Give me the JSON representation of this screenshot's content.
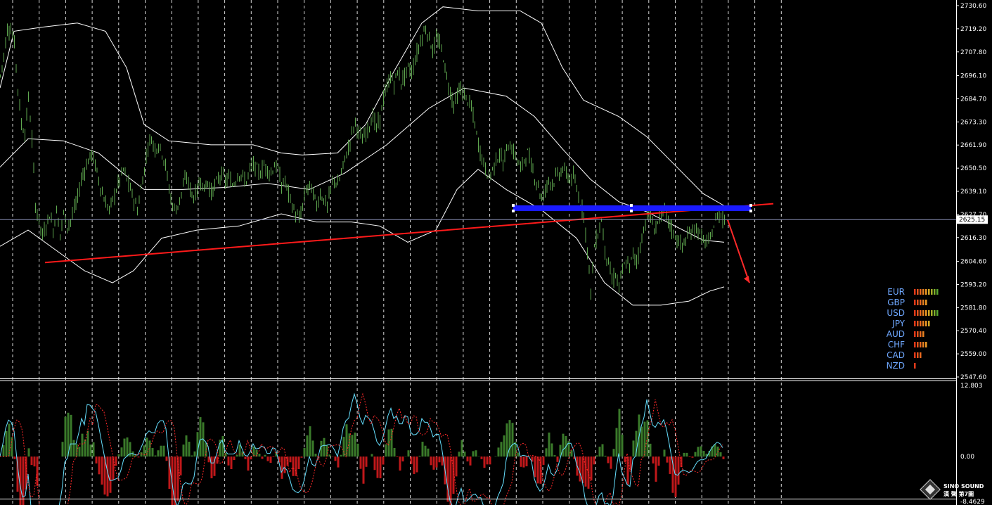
{
  "chart_data": [
    {
      "type": "candlestick",
      "panel": "main",
      "y_ticks": [
        "2730.60",
        "2719.20",
        "2707.80",
        "2696.10",
        "2684.70",
        "2673.30",
        "2661.90",
        "2650.50",
        "2639.10",
        "2627.70",
        "2616.30",
        "2604.60",
        "2593.20",
        "2581.80",
        "2570.40",
        "2559.00",
        "2547.60"
      ],
      "ylim": [
        2547.6,
        2730.6
      ],
      "current_price": "2625.15",
      "price_series": [
        {
          "x": 0,
          "y": 2696
        },
        {
          "x": 5,
          "y": 2706
        },
        {
          "x": 10,
          "y": 2719
        },
        {
          "x": 15,
          "y": 2719
        },
        {
          "x": 20,
          "y": 2712
        },
        {
          "x": 25,
          "y": 2690
        },
        {
          "x": 30,
          "y": 2672
        },
        {
          "x": 35,
          "y": 2668
        },
        {
          "x": 40,
          "y": 2685
        },
        {
          "x": 45,
          "y": 2665
        },
        {
          "x": 50,
          "y": 2632
        },
        {
          "x": 55,
          "y": 2625
        },
        {
          "x": 60,
          "y": 2617
        },
        {
          "x": 65,
          "y": 2622
        },
        {
          "x": 70,
          "y": 2628
        },
        {
          "x": 75,
          "y": 2620
        },
        {
          "x": 80,
          "y": 2630
        },
        {
          "x": 85,
          "y": 2618
        },
        {
          "x": 90,
          "y": 2628
        },
        {
          "x": 95,
          "y": 2622
        },
        {
          "x": 100,
          "y": 2625
        },
        {
          "x": 105,
          "y": 2630
        },
        {
          "x": 110,
          "y": 2636
        },
        {
          "x": 115,
          "y": 2645
        },
        {
          "x": 120,
          "y": 2650
        },
        {
          "x": 125,
          "y": 2654
        },
        {
          "x": 130,
          "y": 2658
        },
        {
          "x": 135,
          "y": 2652
        },
        {
          "x": 140,
          "y": 2645
        },
        {
          "x": 145,
          "y": 2638
        },
        {
          "x": 150,
          "y": 2633
        },
        {
          "x": 155,
          "y": 2630
        },
        {
          "x": 160,
          "y": 2635
        },
        {
          "x": 165,
          "y": 2640
        },
        {
          "x": 170,
          "y": 2645
        },
        {
          "x": 175,
          "y": 2650
        },
        {
          "x": 180,
          "y": 2645
        },
        {
          "x": 185,
          "y": 2640
        },
        {
          "x": 190,
          "y": 2635
        },
        {
          "x": 195,
          "y": 2630
        },
        {
          "x": 200,
          "y": 2640
        },
        {
          "x": 205,
          "y": 2650
        },
        {
          "x": 210,
          "y": 2662
        },
        {
          "x": 215,
          "y": 2665
        },
        {
          "x": 220,
          "y": 2660
        },
        {
          "x": 225,
          "y": 2662
        },
        {
          "x": 230,
          "y": 2658
        },
        {
          "x": 235,
          "y": 2652
        },
        {
          "x": 240,
          "y": 2640
        },
        {
          "x": 245,
          "y": 2632
        },
        {
          "x": 250,
          "y": 2630
        },
        {
          "x": 255,
          "y": 2635
        },
        {
          "x": 260,
          "y": 2642
        },
        {
          "x": 265,
          "y": 2646
        },
        {
          "x": 270,
          "y": 2640
        },
        {
          "x": 275,
          "y": 2636
        },
        {
          "x": 280,
          "y": 2640
        },
        {
          "x": 285,
          "y": 2645
        },
        {
          "x": 290,
          "y": 2640
        },
        {
          "x": 295,
          "y": 2644
        },
        {
          "x": 300,
          "y": 2638
        },
        {
          "x": 305,
          "y": 2642
        },
        {
          "x": 310,
          "y": 2645
        },
        {
          "x": 315,
          "y": 2648
        },
        {
          "x": 320,
          "y": 2644
        },
        {
          "x": 325,
          "y": 2646
        },
        {
          "x": 330,
          "y": 2642
        },
        {
          "x": 335,
          "y": 2645
        },
        {
          "x": 340,
          "y": 2648
        },
        {
          "x": 345,
          "y": 2646
        },
        {
          "x": 350,
          "y": 2644
        },
        {
          "x": 355,
          "y": 2650
        },
        {
          "x": 360,
          "y": 2652
        },
        {
          "x": 365,
          "y": 2650
        },
        {
          "x": 370,
          "y": 2648
        },
        {
          "x": 375,
          "y": 2652
        },
        {
          "x": 380,
          "y": 2650
        },
        {
          "x": 385,
          "y": 2648
        },
        {
          "x": 390,
          "y": 2652
        },
        {
          "x": 395,
          "y": 2650
        },
        {
          "x": 400,
          "y": 2642
        },
        {
          "x": 405,
          "y": 2644
        },
        {
          "x": 410,
          "y": 2638
        },
        {
          "x": 415,
          "y": 2632
        },
        {
          "x": 420,
          "y": 2628
        },
        {
          "x": 425,
          "y": 2625
        },
        {
          "x": 430,
          "y": 2632
        },
        {
          "x": 435,
          "y": 2640
        },
        {
          "x": 440,
          "y": 2642
        },
        {
          "x": 445,
          "y": 2638
        },
        {
          "x": 450,
          "y": 2632
        },
        {
          "x": 455,
          "y": 2638
        },
        {
          "x": 460,
          "y": 2635
        },
        {
          "x": 465,
          "y": 2632
        },
        {
          "x": 470,
          "y": 2640
        },
        {
          "x": 475,
          "y": 2645
        },
        {
          "x": 480,
          "y": 2642
        },
        {
          "x": 485,
          "y": 2648
        },
        {
          "x": 490,
          "y": 2655
        },
        {
          "x": 495,
          "y": 2660
        },
        {
          "x": 500,
          "y": 2668
        },
        {
          "x": 505,
          "y": 2673
        },
        {
          "x": 510,
          "y": 2668
        },
        {
          "x": 515,
          "y": 2664
        },
        {
          "x": 520,
          "y": 2668
        },
        {
          "x": 525,
          "y": 2672
        },
        {
          "x": 530,
          "y": 2676
        },
        {
          "x": 535,
          "y": 2670
        },
        {
          "x": 540,
          "y": 2675
        },
        {
          "x": 545,
          "y": 2685
        },
        {
          "x": 550,
          "y": 2690
        },
        {
          "x": 555,
          "y": 2696
        },
        {
          "x": 560,
          "y": 2692
        },
        {
          "x": 565,
          "y": 2698
        },
        {
          "x": 570,
          "y": 2693
        },
        {
          "x": 575,
          "y": 2696
        },
        {
          "x": 580,
          "y": 2700
        },
        {
          "x": 585,
          "y": 2698
        },
        {
          "x": 590,
          "y": 2704
        },
        {
          "x": 595,
          "y": 2710
        },
        {
          "x": 600,
          "y": 2716
        },
        {
          "x": 605,
          "y": 2719
        },
        {
          "x": 610,
          "y": 2715
        },
        {
          "x": 615,
          "y": 2708
        },
        {
          "x": 620,
          "y": 2714
        },
        {
          "x": 625,
          "y": 2712
        },
        {
          "x": 630,
          "y": 2705
        },
        {
          "x": 635,
          "y": 2695
        },
        {
          "x": 640,
          "y": 2688
        },
        {
          "x": 645,
          "y": 2682
        },
        {
          "x": 650,
          "y": 2686
        },
        {
          "x": 655,
          "y": 2690
        },
        {
          "x": 660,
          "y": 2686
        },
        {
          "x": 665,
          "y": 2684
        },
        {
          "x": 670,
          "y": 2680
        },
        {
          "x": 675,
          "y": 2672
        },
        {
          "x": 680,
          "y": 2662
        },
        {
          "x": 685,
          "y": 2656
        },
        {
          "x": 690,
          "y": 2650
        },
        {
          "x": 695,
          "y": 2646
        },
        {
          "x": 700,
          "y": 2650
        },
        {
          "x": 705,
          "y": 2654
        },
        {
          "x": 710,
          "y": 2658
        },
        {
          "x": 715,
          "y": 2652
        },
        {
          "x": 720,
          "y": 2660
        },
        {
          "x": 725,
          "y": 2662
        },
        {
          "x": 730,
          "y": 2658
        },
        {
          "x": 735,
          "y": 2655
        },
        {
          "x": 740,
          "y": 2650
        },
        {
          "x": 745,
          "y": 2655
        },
        {
          "x": 750,
          "y": 2658
        },
        {
          "x": 755,
          "y": 2652
        },
        {
          "x": 760,
          "y": 2646
        },
        {
          "x": 765,
          "y": 2642
        },
        {
          "x": 770,
          "y": 2635
        },
        {
          "x": 775,
          "y": 2640
        },
        {
          "x": 780,
          "y": 2645
        },
        {
          "x": 785,
          "y": 2643
        },
        {
          "x": 790,
          "y": 2646
        },
        {
          "x": 795,
          "y": 2648
        },
        {
          "x": 800,
          "y": 2650
        },
        {
          "x": 805,
          "y": 2648
        },
        {
          "x": 810,
          "y": 2645
        },
        {
          "x": 815,
          "y": 2646
        },
        {
          "x": 820,
          "y": 2640
        },
        {
          "x": 825,
          "y": 2633
        },
        {
          "x": 830,
          "y": 2628
        },
        {
          "x": 835,
          "y": 2610
        },
        {
          "x": 840,
          "y": 2590
        },
        {
          "x": 845,
          "y": 2612
        },
        {
          "x": 850,
          "y": 2618
        },
        {
          "x": 855,
          "y": 2625
        },
        {
          "x": 860,
          "y": 2610
        },
        {
          "x": 865,
          "y": 2604
        },
        {
          "x": 870,
          "y": 2595
        },
        {
          "x": 875,
          "y": 2598
        },
        {
          "x": 880,
          "y": 2592
        },
        {
          "x": 885,
          "y": 2600
        },
        {
          "x": 890,
          "y": 2604
        },
        {
          "x": 895,
          "y": 2602
        },
        {
          "x": 900,
          "y": 2608
        },
        {
          "x": 905,
          "y": 2605
        },
        {
          "x": 910,
          "y": 2612
        },
        {
          "x": 915,
          "y": 2620
        },
        {
          "x": 920,
          "y": 2628
        },
        {
          "x": 925,
          "y": 2626
        },
        {
          "x": 930,
          "y": 2620
        },
        {
          "x": 935,
          "y": 2624
        },
        {
          "x": 940,
          "y": 2628
        },
        {
          "x": 945,
          "y": 2629
        },
        {
          "x": 950,
          "y": 2625
        },
        {
          "x": 955,
          "y": 2620
        },
        {
          "x": 960,
          "y": 2617
        },
        {
          "x": 965,
          "y": 2614
        },
        {
          "x": 970,
          "y": 2612
        },
        {
          "x": 975,
          "y": 2615
        },
        {
          "x": 980,
          "y": 2618
        },
        {
          "x": 985,
          "y": 2620
        },
        {
          "x": 990,
          "y": 2621
        },
        {
          "x": 995,
          "y": 2618
        },
        {
          "x": 1000,
          "y": 2615
        },
        {
          "x": 1005,
          "y": 2613
        },
        {
          "x": 1010,
          "y": 2616
        },
        {
          "x": 1015,
          "y": 2622
        },
        {
          "x": 1020,
          "y": 2627
        },
        {
          "x": 1025,
          "y": 2628
        },
        {
          "x": 1030,
          "y": 2625
        }
      ],
      "bollinger_upper": [
        {
          "x": 0,
          "y": 2690
        },
        {
          "x": 20,
          "y": 2718
        },
        {
          "x": 60,
          "y": 2720
        },
        {
          "x": 110,
          "y": 2722
        },
        {
          "x": 150,
          "y": 2718
        },
        {
          "x": 180,
          "y": 2700
        },
        {
          "x": 205,
          "y": 2672
        },
        {
          "x": 240,
          "y": 2664
        },
        {
          "x": 300,
          "y": 2662
        },
        {
          "x": 360,
          "y": 2662
        },
        {
          "x": 400,
          "y": 2658
        },
        {
          "x": 430,
          "y": 2657
        },
        {
          "x": 480,
          "y": 2658
        },
        {
          "x": 520,
          "y": 2672
        },
        {
          "x": 560,
          "y": 2698
        },
        {
          "x": 600,
          "y": 2722
        },
        {
          "x": 630,
          "y": 2730
        },
        {
          "x": 680,
          "y": 2728
        },
        {
          "x": 740,
          "y": 2728
        },
        {
          "x": 770,
          "y": 2722
        },
        {
          "x": 800,
          "y": 2700
        },
        {
          "x": 830,
          "y": 2684
        },
        {
          "x": 880,
          "y": 2676
        },
        {
          "x": 920,
          "y": 2666
        },
        {
          "x": 960,
          "y": 2652
        },
        {
          "x": 1000,
          "y": 2638
        },
        {
          "x": 1030,
          "y": 2632
        }
      ],
      "bollinger_middle": [
        {
          "x": 0,
          "y": 2651
        },
        {
          "x": 40,
          "y": 2665
        },
        {
          "x": 90,
          "y": 2664
        },
        {
          "x": 140,
          "y": 2658
        },
        {
          "x": 175,
          "y": 2648
        },
        {
          "x": 205,
          "y": 2640
        },
        {
          "x": 260,
          "y": 2640
        },
        {
          "x": 320,
          "y": 2641
        },
        {
          "x": 380,
          "y": 2643
        },
        {
          "x": 440,
          "y": 2640
        },
        {
          "x": 490,
          "y": 2648
        },
        {
          "x": 550,
          "y": 2662
        },
        {
          "x": 610,
          "y": 2680
        },
        {
          "x": 660,
          "y": 2690
        },
        {
          "x": 720,
          "y": 2686
        },
        {
          "x": 760,
          "y": 2676
        },
        {
          "x": 800,
          "y": 2660
        },
        {
          "x": 840,
          "y": 2645
        },
        {
          "x": 880,
          "y": 2634
        },
        {
          "x": 920,
          "y": 2629
        },
        {
          "x": 960,
          "y": 2622
        },
        {
          "x": 1000,
          "y": 2615
        },
        {
          "x": 1030,
          "y": 2614
        }
      ],
      "bollinger_lower": [
        {
          "x": 0,
          "y": 2612
        },
        {
          "x": 40,
          "y": 2620
        },
        {
          "x": 80,
          "y": 2610
        },
        {
          "x": 120,
          "y": 2600
        },
        {
          "x": 160,
          "y": 2594
        },
        {
          "x": 190,
          "y": 2600
        },
        {
          "x": 230,
          "y": 2616
        },
        {
          "x": 280,
          "y": 2620
        },
        {
          "x": 340,
          "y": 2622
        },
        {
          "x": 400,
          "y": 2628
        },
        {
          "x": 450,
          "y": 2624
        },
        {
          "x": 500,
          "y": 2624
        },
        {
          "x": 540,
          "y": 2622
        },
        {
          "x": 580,
          "y": 2614
        },
        {
          "x": 620,
          "y": 2620
        },
        {
          "x": 650,
          "y": 2640
        },
        {
          "x": 680,
          "y": 2650
        },
        {
          "x": 720,
          "y": 2640
        },
        {
          "x": 770,
          "y": 2630
        },
        {
          "x": 820,
          "y": 2616
        },
        {
          "x": 860,
          "y": 2594
        },
        {
          "x": 900,
          "y": 2583
        },
        {
          "x": 940,
          "y": 2583
        },
        {
          "x": 980,
          "y": 2585
        },
        {
          "x": 1010,
          "y": 2590
        },
        {
          "x": 1030,
          "y": 2592
        }
      ],
      "trendline_red": [
        {
          "x": 64,
          "y": 2604
        },
        {
          "x": 1100,
          "y": 2633
        }
      ],
      "resistance_blue": [
        {
          "x": 730,
          "y": 2630.8
        },
        {
          "x": 1068,
          "y": 2630.8
        }
      ],
      "arrow_red": [
        {
          "x": 1035,
          "y": 2625
        },
        {
          "x": 1066,
          "y": 2594
        }
      ],
      "grid": true
    },
    {
      "type": "histogram-line",
      "panel": "oscillator",
      "y_ticks": [
        "12.803",
        "0.00",
        "-8.4629"
      ],
      "ylim": [
        -8.4629,
        12.803
      ],
      "grid": true
    }
  ],
  "currency_strength": [
    {
      "name": "EUR",
      "value": 9
    },
    {
      "name": "GBP",
      "value": 5
    },
    {
      "name": "USD",
      "value": 9
    },
    {
      "name": "JPY",
      "value": 6
    },
    {
      "name": "AUD",
      "value": 4
    },
    {
      "name": "CHF",
      "value": 5
    },
    {
      "name": "CAD",
      "value": 3
    },
    {
      "name": "NZD",
      "value": 1
    }
  ],
  "colors": {
    "background": "#000000",
    "candles": "#5fa84f",
    "band": "#ffffff",
    "grid": "#ffffff",
    "trendline": "#ff1a1a",
    "resistance": "#1a1aff",
    "signal": "#ff2a2a",
    "macd_line": "#66e0ff",
    "hist_pos": "#3a7a2a",
    "hist_neg": "#c0181a",
    "currency_text": "#6fa8ff"
  },
  "logo": {
    "title": "SINO SOUND",
    "subtitle": "漢 聲  第7圖"
  }
}
